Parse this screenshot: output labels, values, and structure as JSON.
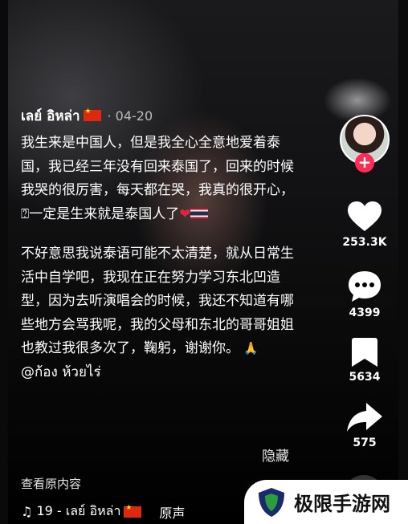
{
  "post": {
    "author": "เลย์ อิหล่า",
    "date_sep": " · ",
    "date": "04-20",
    "paragraph1": "我生来是中国人，但是我全心全意地爱着泰国，我已经三年没有回来泰国了，回来的时候我哭的很厉害，每天都在哭，我真的很开心，⍰一定是生来就是泰国人了",
    "paragraph2": "不好意思我说泰语可能不太清楚，就从日常生活中自学吧，我现在正在努力学习东北凹造型，因为去听演唱会的时候，我还不知道有哪些地方会骂我呢，我的父母和东北的哥哥姐姐也教过我很多次了，鞠躬，谢谢你。",
    "pray_emoji": "🙏",
    "mention": "@ก้อง ห้วยไร่",
    "hide_label": "隐藏",
    "view_original_label": "查看原内容",
    "heart_emoji": "❤"
  },
  "music": {
    "note_icon": "♫",
    "text": "19 - เลย์ อิหล่า",
    "original_label": "原声"
  },
  "rail": {
    "follow_symbol": "+",
    "likes": "253.3K",
    "comments": "4399",
    "saves": "5634",
    "shares": "575"
  },
  "watermark": {
    "text": "极限手游网"
  },
  "colors": {
    "like_heart": "#ffffff",
    "follow_button": "#fe2c55",
    "cn_flag": "#de2910"
  }
}
